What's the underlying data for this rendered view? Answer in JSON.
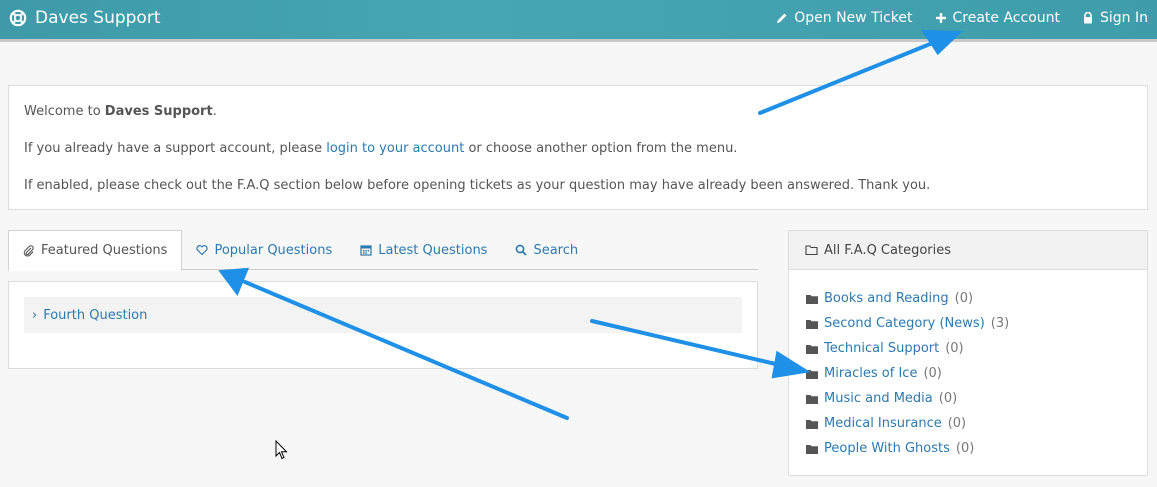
{
  "header": {
    "brand": "Daves Support",
    "nav": [
      {
        "label": "Open New Ticket",
        "icon": "pencil-icon"
      },
      {
        "label": "Create Account",
        "icon": "plus-icon"
      },
      {
        "label": "Sign In",
        "icon": "lock-icon"
      }
    ]
  },
  "welcome": {
    "line1_prefix": "Welcome to ",
    "line1_bold": "Daves Support",
    "line1_suffix": ".",
    "line2_prefix": "If you already have a support account, please ",
    "line2_link": "login to your account",
    "line2_suffix": " or choose another option from the menu.",
    "line3": "If enabled, please check out the F.A.Q section below before opening tickets as your question may have already been answered. Thank you."
  },
  "tabs": [
    {
      "label": "Featured Questions",
      "icon": "paperclip-icon",
      "active": true
    },
    {
      "label": "Popular Questions",
      "icon": "heart-icon",
      "active": false
    },
    {
      "label": "Latest Questions",
      "icon": "calendar-icon",
      "active": false
    },
    {
      "label": "Search",
      "icon": "search-icon",
      "active": false
    }
  ],
  "questions": [
    {
      "label": "Fourth Question"
    }
  ],
  "categories": {
    "title": "All F.A.Q Categories",
    "items": [
      {
        "label": "Books and Reading",
        "count": "(0)"
      },
      {
        "label": "Second Category (News)",
        "count": "(3)"
      },
      {
        "label": "Technical Support",
        "count": "(0)"
      },
      {
        "label": "Miracles of Ice",
        "count": "(0)"
      },
      {
        "label": "Music and Media",
        "count": "(0)"
      },
      {
        "label": "Medical Insurance",
        "count": "(0)"
      },
      {
        "label": "People With Ghosts",
        "count": "(0)"
      }
    ]
  },
  "colors": {
    "header": "#43a2b0",
    "link": "#2a7ab0",
    "annotation_arrow": "#1e90e8"
  }
}
